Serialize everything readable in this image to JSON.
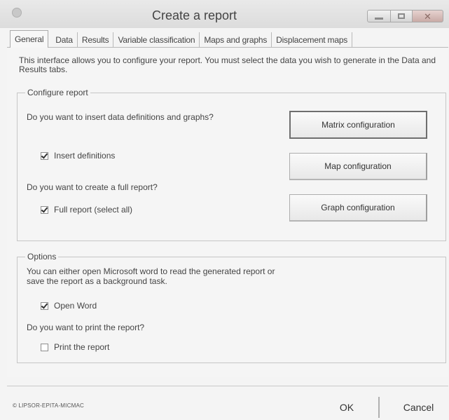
{
  "window": {
    "title": "Create a report"
  },
  "tabs": [
    {
      "label": "General",
      "active": true
    },
    {
      "label": "Data"
    },
    {
      "label": "Results"
    },
    {
      "label": "Variable classification"
    },
    {
      "label": "Maps and graphs"
    },
    {
      "label": "Displacement maps"
    }
  ],
  "intro": "This interface allows you to configure your report. You must select the data you wish to generate in the Data and Results tabs.",
  "configure": {
    "legend": "Configure report",
    "q_definitions": "Do you want to insert data definitions and graphs?",
    "insert_definitions": {
      "label": "Insert definitions",
      "checked": true
    },
    "q_full": "Do you want to create a full report?",
    "full_report": {
      "label": "Full report (select all)",
      "checked": true
    },
    "matrix_button": "Matrix configuration",
    "map_button": "Map configuration",
    "graph_button": "Graph configuration"
  },
  "options": {
    "legend": "Options",
    "description": "You can either open Microsoft word to read the generated report or save the report as a background task.",
    "open_word": {
      "label": "Open Word",
      "checked": true
    },
    "q_print": "Do you want to print the report?",
    "print_report": {
      "label": "Print the report",
      "checked": false
    }
  },
  "footer": {
    "brand": "© LIPSOR-EPITA-MICMAC",
    "ok": "OK",
    "cancel": "Cancel"
  }
}
